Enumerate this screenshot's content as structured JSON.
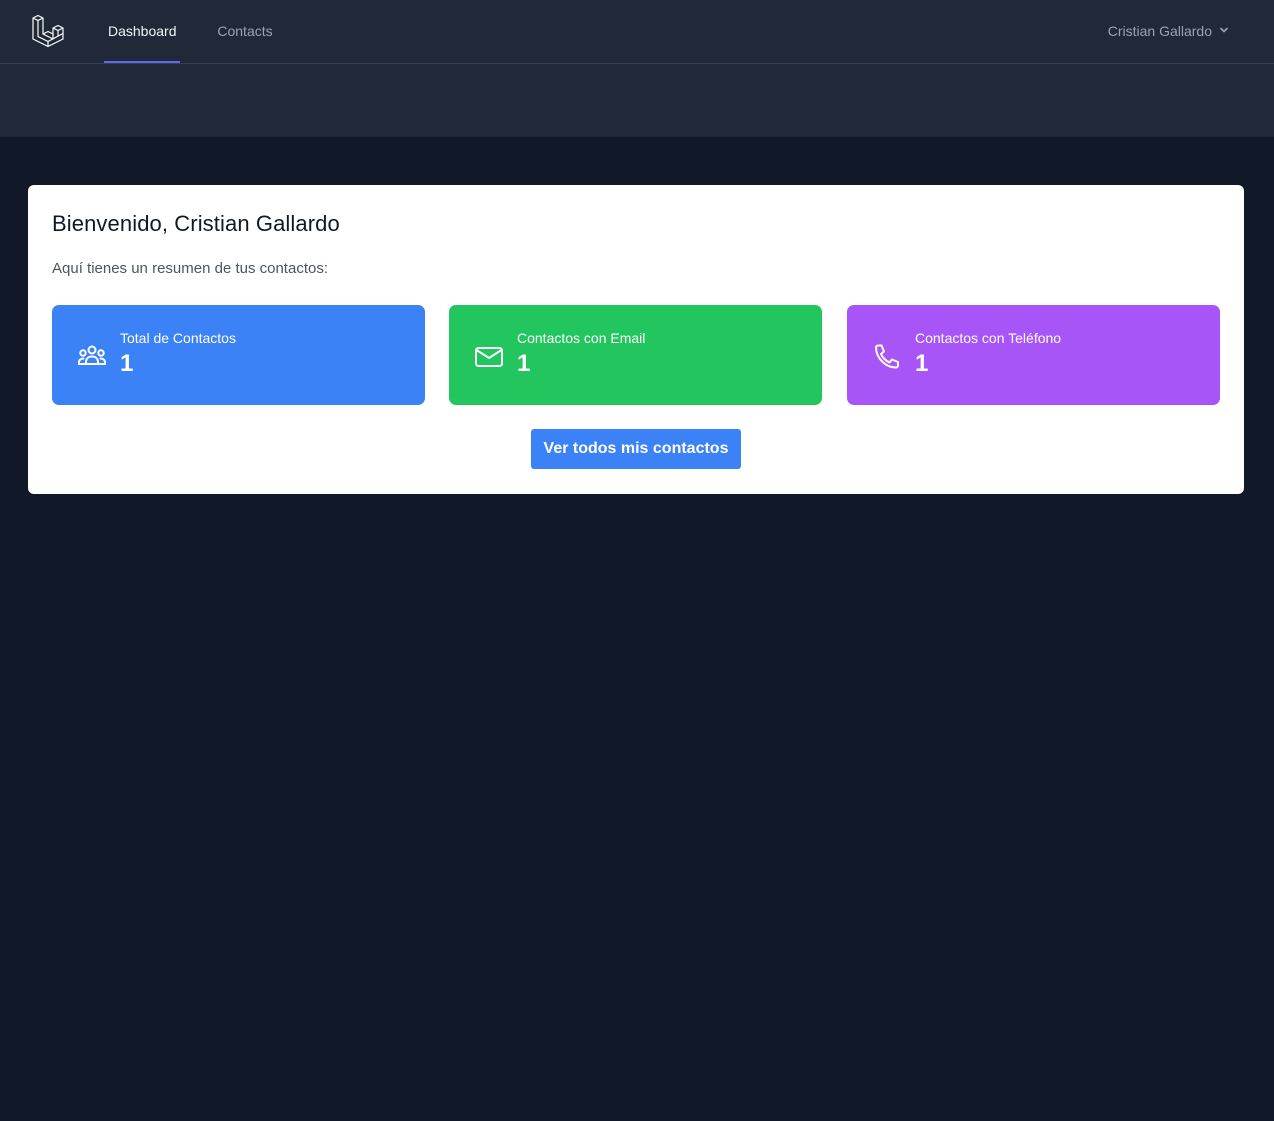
{
  "nav": {
    "logo_icon": "laravel-logo-icon",
    "links": [
      {
        "label": "Dashboard",
        "active": true
      },
      {
        "label": "Contacts",
        "active": false
      }
    ],
    "user": {
      "name": "Cristian Gallardo",
      "icon": "chevron-down-icon"
    }
  },
  "welcome": {
    "title": "Bienvenido, Cristian Gallardo",
    "subtitle": "Aquí tienes un resumen de tus contactos:"
  },
  "stats": [
    {
      "label": "Total de Contactos",
      "value": "1",
      "icon": "users-icon",
      "color": "#3b82f6"
    },
    {
      "label": "Contactos con Email",
      "value": "1",
      "icon": "envelope-icon",
      "color": "#22c55e"
    },
    {
      "label": "Contactos con Teléfono",
      "value": "1",
      "icon": "phone-icon",
      "color": "#a855f7"
    }
  ],
  "cta": {
    "label": "Ver todos mis contactos"
  },
  "colors": {
    "page_bg": "#111827",
    "nav_bg": "#1f2937",
    "active_underline": "#6366f1",
    "card_bg": "#ffffff",
    "button": "#3b82f6"
  }
}
